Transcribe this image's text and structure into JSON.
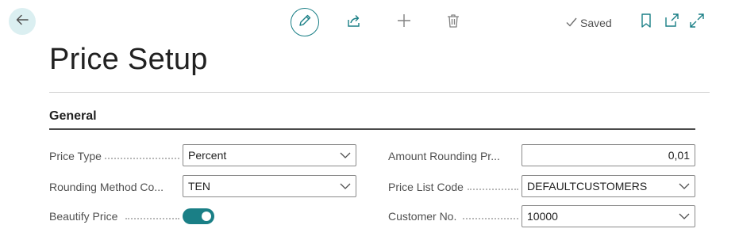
{
  "toolbar": {
    "back_icon": "arrow-left-icon",
    "edit_icon": "pencil-icon",
    "share_icon": "share-icon",
    "add_icon": "plus-icon",
    "delete_icon": "trash-icon",
    "saved_label": "Saved",
    "bookmark_icon": "bookmark-icon",
    "open_new_window_icon": "open-in-new-window-icon",
    "expand_icon": "expand-icon"
  },
  "page": {
    "title": "Price Setup"
  },
  "general": {
    "section_title": "General",
    "fields": {
      "price_type": {
        "label": "Price Type",
        "value": "Percent"
      },
      "rounding_method": {
        "label": "Rounding Method Co...",
        "value": "TEN"
      },
      "beautify_price": {
        "label": "Beautify Price",
        "value": true
      },
      "amount_rounding": {
        "label": "Amount Rounding Pr...",
        "value": "0,01"
      },
      "price_list_code": {
        "label": "Price List Code",
        "value": "DEFAULTCUSTOMERS"
      },
      "customer_no": {
        "label": "Customer No.",
        "value": "10000"
      }
    }
  },
  "colors": {
    "accent": "#1a7f86",
    "back_button_bg": "#dbeff1"
  }
}
